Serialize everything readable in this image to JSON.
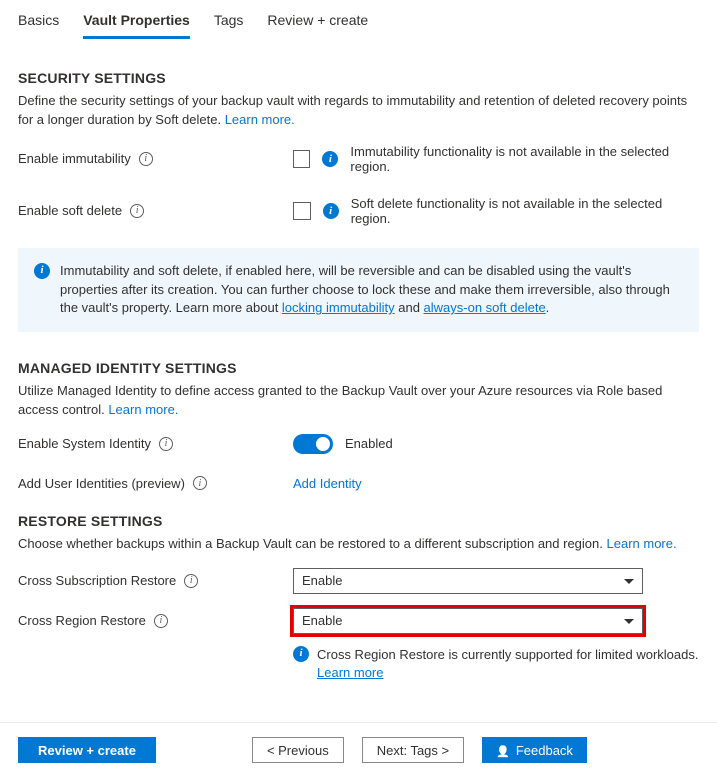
{
  "tabs": {
    "basics": "Basics",
    "vault_properties": "Vault Properties",
    "tags": "Tags",
    "review_create": "Review + create"
  },
  "security": {
    "title": "SECURITY SETTINGS",
    "desc_1": "Define the security settings of your backup vault with regards to immutability and retention of deleted recovery points for a longer duration by Soft delete. ",
    "learn_more": "Learn more.",
    "enable_immutability_label": "Enable immutability",
    "immutability_msg": "Immutability functionality is not available in the selected region.",
    "enable_soft_delete_label": "Enable soft delete",
    "soft_delete_msg": "Soft delete functionality is not available in the selected region.",
    "info_box_pre": "Immutability and soft delete, if enabled here, will be reversible and can be disabled using the vault's properties after its creation. You can further choose to lock these and make them irreversible, also through the vault's property. Learn more about ",
    "info_link1": "locking immutability",
    "info_box_mid": " and ",
    "info_link2": "always-on soft delete",
    "info_box_end": "."
  },
  "identity": {
    "title": "MANAGED IDENTITY SETTINGS",
    "desc_1": "Utilize Managed Identity to define access granted to the Backup Vault over your Azure resources via Role based access control. ",
    "learn_more": "Learn more.",
    "enable_system_label": "Enable System Identity",
    "enabled_text": "Enabled",
    "add_user_label": "Add User Identities (preview)",
    "add_identity_link": "Add Identity"
  },
  "restore": {
    "title": "RESTORE SETTINGS",
    "desc_1": "Choose whether backups within a Backup Vault can be restored to a different subscription and region. ",
    "learn_more": "Learn more.",
    "csr_label": "Cross Subscription Restore",
    "csr_value": "Enable",
    "crr_label": "Cross Region Restore",
    "crr_value": "Enable",
    "crr_note": "Cross Region Restore is currently supported for limited workloads. ",
    "crr_note_link": "Learn more"
  },
  "footer": {
    "review_create": "Review + create",
    "previous": "< Previous",
    "next": "Next: Tags >",
    "feedback": "Feedback"
  }
}
